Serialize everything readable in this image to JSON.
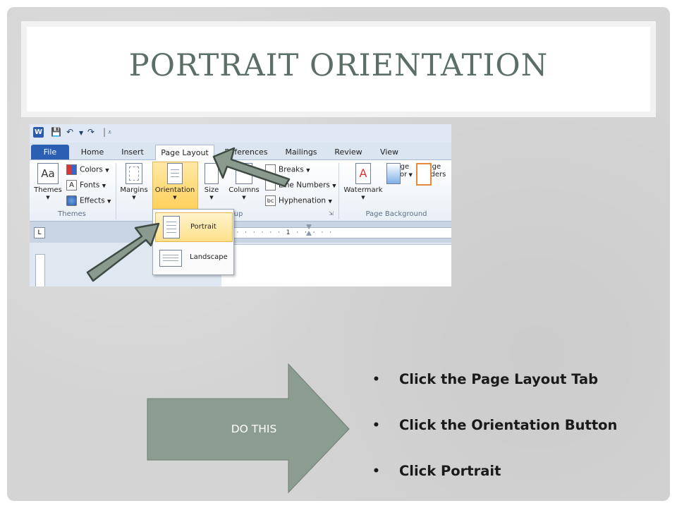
{
  "slide": {
    "title": "PORTRAIT ORIENTATION",
    "callout_label": "DO THIS",
    "steps": [
      "Click the Page Layout Tab",
      "Click the Orientation Button",
      "Click Portrait"
    ],
    "bullet": "•"
  },
  "word": {
    "app_icon": "W",
    "tabs": [
      "File",
      "Home",
      "Insert",
      "Page Layout",
      "References",
      "Mailings",
      "Review",
      "View"
    ],
    "themes_group": {
      "themes": "Themes",
      "colors": "Colors",
      "fonts": "Fonts",
      "effects": "Effects",
      "label": "Themes"
    },
    "page_setup": {
      "margins": "Margins",
      "orientation": "Orientation",
      "size": "Size",
      "columns": "Columns",
      "breaks": "Breaks",
      "line_numbers": "Line Numbers",
      "hyphenation": "Hyphenation",
      "label_fragment": "up"
    },
    "page_background": {
      "watermark": "Watermark",
      "page_color_1": "Page",
      "page_color_2": "Color",
      "page_borders_1": "Page",
      "page_borders_2": "Borders",
      "label": "Page Background"
    },
    "orientation_menu": {
      "portrait": "Portrait",
      "landscape": "Landscape"
    },
    "ruler_text": "· · · · · · · · 1 · · · · ·",
    "ruler_corner": "L"
  },
  "colors": {
    "title": "#5b6f66",
    "arrow_fill": "#8a9a8e",
    "arrow_stroke": "#3f4a42",
    "callout_fill": "#8b9c91",
    "word_file_tab": "#2a5fb4"
  }
}
